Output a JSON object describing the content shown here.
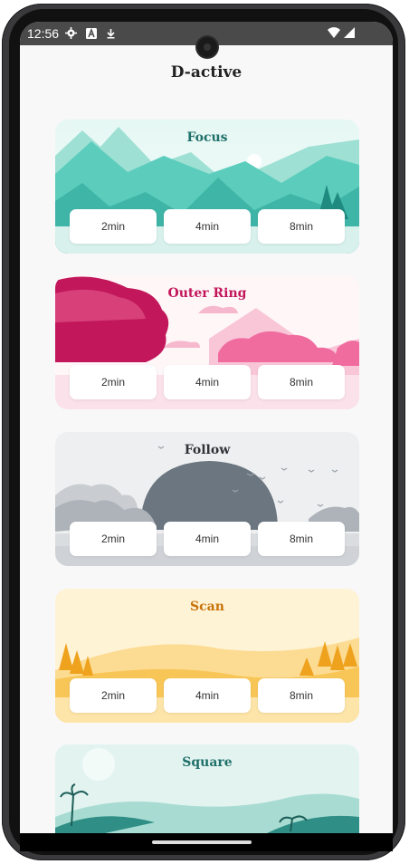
{
  "status_bar": {
    "time": "12:56"
  },
  "app": {
    "title": "D-active"
  },
  "sessions": [
    {
      "title": "Focus",
      "title_color": "#1f6f6a",
      "durations": [
        "2min",
        "4min",
        "8min"
      ]
    },
    {
      "title": "Outer Ring",
      "title_color": "#c2185b",
      "durations": [
        "2min",
        "4min",
        "8min"
      ]
    },
    {
      "title": "Follow",
      "title_color": "#2f3438",
      "durations": [
        "2min",
        "4min",
        "8min"
      ]
    },
    {
      "title": "Scan",
      "title_color": "#c8720a",
      "durations": [
        "2min",
        "4min",
        "8min"
      ]
    },
    {
      "title": "Square",
      "title_color": "#1f6f6a",
      "durations": []
    }
  ],
  "icons": {
    "status": [
      "gear-icon",
      "a-icon",
      "download-icon"
    ],
    "right": [
      "wifi-icon",
      "signal-icon",
      "battery-icon"
    ]
  }
}
